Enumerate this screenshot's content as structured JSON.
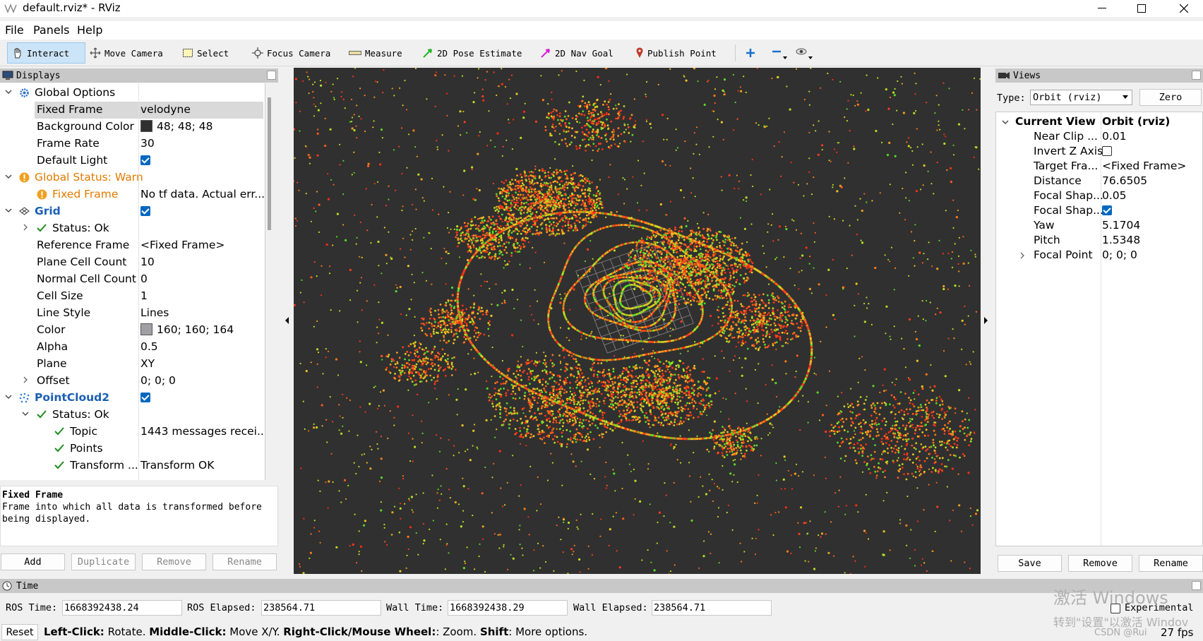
{
  "window": {
    "title": "default.rviz* - RViz"
  },
  "menu": [
    "File",
    "Panels",
    "Help"
  ],
  "toolbar": {
    "tools": [
      {
        "label": "Interact",
        "icon": "interact-hand-icon",
        "active": true
      },
      {
        "label": "Move Camera",
        "icon": "move-camera-icon",
        "active": false
      },
      {
        "label": "Select",
        "icon": "select-box-icon",
        "active": false
      },
      {
        "label": "Focus Camera",
        "icon": "focus-camera-icon",
        "active": false
      },
      {
        "label": "Measure",
        "icon": "ruler-icon",
        "active": false
      },
      {
        "label": "2D Pose Estimate",
        "icon": "green-arrow-icon",
        "active": false
      },
      {
        "label": "2D Nav Goal",
        "icon": "magenta-arrow-icon",
        "active": false
      },
      {
        "label": "Publish Point",
        "icon": "map-pin-icon",
        "active": false
      }
    ]
  },
  "displays": {
    "title": "Displays",
    "rows": [
      {
        "label": "Global Options",
        "value": ""
      },
      {
        "label": "Fixed Frame",
        "value": "velodyne"
      },
      {
        "label": "Background Color",
        "value": "48; 48; 48",
        "swatch": "#303030"
      },
      {
        "label": "Frame Rate",
        "value": "30"
      },
      {
        "label": "Default Light",
        "value": "",
        "checked": true
      },
      {
        "label": "Global Status: Warn",
        "value": ""
      },
      {
        "label": "Fixed Frame",
        "value": "No tf data.  Actual err..."
      },
      {
        "label": "Grid",
        "value": "",
        "checked": true
      },
      {
        "label": "Status: Ok",
        "value": ""
      },
      {
        "label": "Reference Frame",
        "value": "<Fixed Frame>"
      },
      {
        "label": "Plane Cell Count",
        "value": "10"
      },
      {
        "label": "Normal Cell Count",
        "value": "0"
      },
      {
        "label": "Cell Size",
        "value": "1"
      },
      {
        "label": "Line Style",
        "value": "Lines"
      },
      {
        "label": "Color",
        "value": "160; 160; 164",
        "swatch": "#a0a0a4"
      },
      {
        "label": "Alpha",
        "value": "0.5"
      },
      {
        "label": "Plane",
        "value": "XY"
      },
      {
        "label": "Offset",
        "value": "0; 0; 0"
      },
      {
        "label": "PointCloud2",
        "value": "",
        "checked": true
      },
      {
        "label": "Status: Ok",
        "value": ""
      },
      {
        "label": "Topic",
        "value": "1443 messages recei..."
      },
      {
        "label": "Points",
        "value": ""
      },
      {
        "label": "Transform ...",
        "value": "Transform OK"
      }
    ],
    "description_title": "Fixed Frame",
    "description_text": "Frame into which all data is transformed before being displayed.",
    "buttons": {
      "add": "Add",
      "duplicate": "Duplicate",
      "remove": "Remove",
      "rename": "Rename"
    }
  },
  "views": {
    "title": "Views",
    "type_label": "Type:",
    "type_value": "Orbit (rviz)",
    "zero_label": "Zero",
    "rows": [
      {
        "label": "Current View",
        "value": "Orbit (rviz)"
      },
      {
        "label": "Near Clip ...",
        "value": "0.01"
      },
      {
        "label": "Invert Z Axis",
        "value": "",
        "checked": false
      },
      {
        "label": "Target Fra...",
        "value": "<Fixed Frame>"
      },
      {
        "label": "Distance",
        "value": "76.6505"
      },
      {
        "label": "Focal Shap...",
        "value": "0.05"
      },
      {
        "label": "Focal Shap...",
        "value": "",
        "checked": true
      },
      {
        "label": "Yaw",
        "value": "5.1704"
      },
      {
        "label": "Pitch",
        "value": "1.5348"
      },
      {
        "label": "Focal Point",
        "value": "0; 0; 0"
      }
    ],
    "buttons": {
      "save": "Save",
      "remove": "Remove",
      "rename": "Rename"
    }
  },
  "time": {
    "title": "Time",
    "ros_time_label": "ROS Time:",
    "ros_time": "1668392438.24",
    "ros_elapsed_label": "ROS Elapsed:",
    "ros_elapsed": "238564.71",
    "wall_time_label": "Wall Time:",
    "wall_time": "1668392438.29",
    "wall_elapsed_label": "Wall Elapsed:",
    "wall_elapsed": "238564.71",
    "experimental_label": "Experimental"
  },
  "status": {
    "reset_label": "Reset",
    "left_click": "Left-Click:",
    "left_click_desc": " Rotate. ",
    "middle_click": "Middle-Click:",
    "middle_click_desc": " Move X/Y. ",
    "right_click": "Right-Click/Mouse Wheel:",
    "right_click_desc": ": Zoom. ",
    "shift": "Shift",
    "shift_desc": ": More options.",
    "fps": "27 fps"
  },
  "watermark": {
    "line1": "激活 Windows",
    "line2": "转到\"设置\"以激活 Windov",
    "csdn": "CSDN @Rui"
  },
  "colors": {
    "warn": "#e07b00",
    "link_blue": "#1a5fb4",
    "check_blue": "#0067c0",
    "viewport_bg": "#303030"
  }
}
